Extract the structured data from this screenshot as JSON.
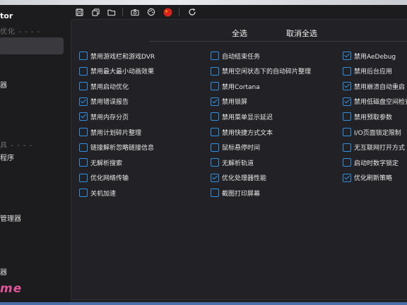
{
  "sidebar": {
    "title": "tor",
    "section_1": "优化 - - - -",
    "item_1": "器",
    "section_2": "具 - - - -",
    "item_2": "程序",
    "item_3": "管理器",
    "item_4": "器",
    "logo": "me"
  },
  "toolbar": {
    "icons": [
      "save-icon",
      "copy-icon",
      "open-folder-icon",
      "camera-icon",
      "theme-icon",
      "language-china-flag-icon",
      "refresh-icon"
    ]
  },
  "panel": {
    "select_all": "全选",
    "deselect_all": "取消全选",
    "col1": [
      {
        "label": "禁用游戏栏和游戏DVR",
        "checked": false
      },
      {
        "label": "禁用最大最小动画效果",
        "checked": false
      },
      {
        "label": "禁用启动优化",
        "checked": false
      },
      {
        "label": "禁用错误报告",
        "checked": true
      },
      {
        "label": "禁用内存分页",
        "checked": true
      },
      {
        "label": "禁用计划碎片整理",
        "checked": false
      },
      {
        "label": "链接解析忽略链接信息",
        "checked": false
      },
      {
        "label": "无解析搜索",
        "checked": false
      },
      {
        "label": "优化网络传输",
        "checked": false
      },
      {
        "label": "关机加速",
        "checked": false
      }
    ],
    "col2": [
      {
        "label": "自动结束任务",
        "checked": false
      },
      {
        "label": "禁用空闲状态下的自动碎片整理",
        "checked": false
      },
      {
        "label": "禁用Cortana",
        "checked": false
      },
      {
        "label": "禁用锁屏",
        "checked": true
      },
      {
        "label": "禁用菜单显示延迟",
        "checked": false
      },
      {
        "label": "禁用快捷方式文本",
        "checked": false
      },
      {
        "label": "鼠标悬停时间",
        "checked": false
      },
      {
        "label": "无解析轨道",
        "checked": false
      },
      {
        "label": "优化处理器性能",
        "checked": true
      },
      {
        "label": "截图打印屏幕",
        "checked": false
      }
    ],
    "col3": [
      {
        "label": "禁用AeDebug",
        "checked": true
      },
      {
        "label": "禁用后台应用",
        "checked": false
      },
      {
        "label": "禁用崩溃自动重启",
        "checked": true
      },
      {
        "label": "禁用低磁盘空间检查",
        "checked": true
      },
      {
        "label": "禁用预取参数",
        "checked": false
      },
      {
        "label": "I/O页面锁定限制",
        "checked": false
      },
      {
        "label": "无互联网打开方式",
        "checked": false
      },
      {
        "label": "启动时数字锁定",
        "checked": false
      },
      {
        "label": "优化刷新策略",
        "checked": true
      }
    ]
  },
  "colors": {
    "accent": "#2f8fe0",
    "background": "#1f1f22",
    "logo": "#e0559a"
  }
}
